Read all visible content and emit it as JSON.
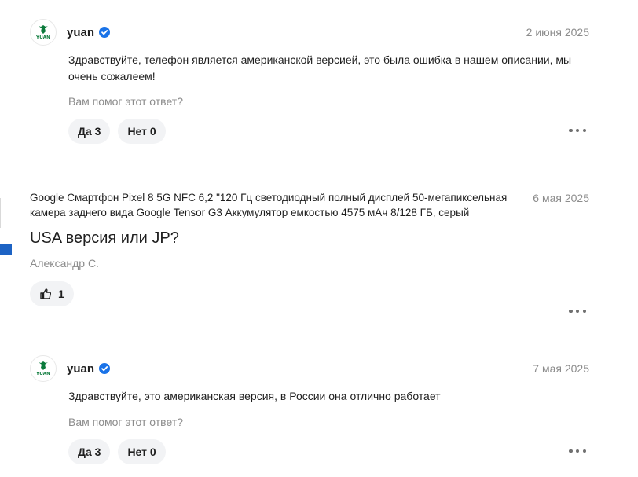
{
  "answers": [
    {
      "seller": "yuan",
      "avatar_text": "YUAN",
      "date": "2 июня 2025",
      "text": "Здравствуйте, телефон является американской версией, это была ошибка в нашем описании, мы очень сожалеем!",
      "helpful_prompt": "Вам помог этот ответ?",
      "yes_label": "Да 3",
      "no_label": "Нет 0"
    },
    {
      "seller": "yuan",
      "avatar_text": "YUAN",
      "date": "7 мая 2025",
      "text": "Здравствуйте, это американская версия, в России она отлично работает",
      "helpful_prompt": "Вам помог этот ответ?",
      "yes_label": "Да 3",
      "no_label": "Нет 0"
    }
  ],
  "question": {
    "product": "Google Смартфон Pixel 8 5G NFC 6,2 \"120 Гц светодиодный полный дисплей 50-мегапиксельная камера заднего вида Google Tensor G3 Аккумулятор емкостью 4575 мАч 8/128 ГБ, серый",
    "date": "6 мая 2025",
    "title": "USA версия или JP?",
    "author": "Александр С.",
    "likes": "1"
  },
  "icons": {
    "verified": "verified-check-icon",
    "like": "thumbs-up-icon",
    "more": "more-dots-icon",
    "avatar": "seller-logo-icon"
  },
  "colors": {
    "accent": "#1d63c4",
    "verified": "#1a73e8",
    "muted": "#8c8c8c",
    "pill_bg": "#f2f3f5",
    "logo_green": "#0b7a3b"
  }
}
